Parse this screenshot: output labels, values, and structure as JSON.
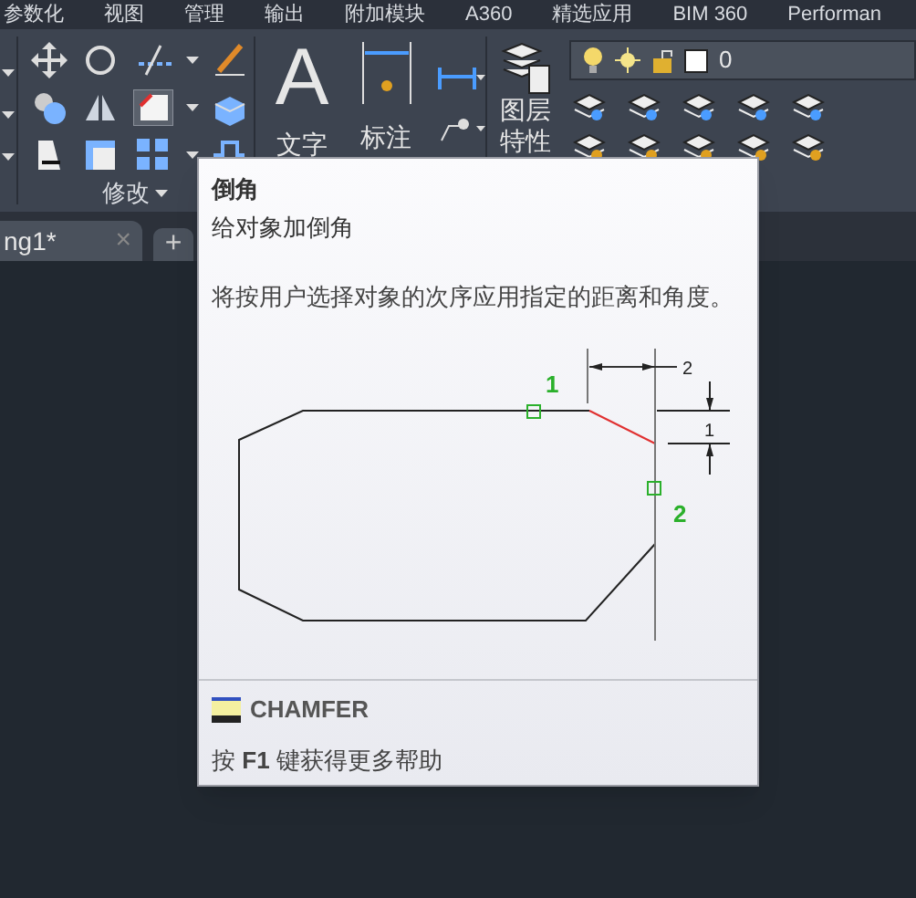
{
  "menu_tabs": [
    "参数化",
    "视图",
    "管理",
    "输出",
    "附加模块",
    "A360",
    "精选应用",
    "BIM 360",
    "Performan"
  ],
  "ribbon": {
    "panel_label": "修改",
    "text_glyph": "A",
    "text_button": "文字",
    "dimension_button": "标注",
    "layer_button": [
      "图层",
      "特性"
    ],
    "layer_value": "0"
  },
  "doc_tabs": [
    {
      "label": "ng1*",
      "selected": true,
      "close": "×"
    }
  ],
  "new_tab": "+",
  "tooltip": {
    "title": "倒角",
    "subtitle": "给对象加倒角",
    "description": "将按用户选择对象的次序应用指定的距离和角度。",
    "diagram": {
      "pick_labels": [
        "1",
        "2"
      ],
      "dimension_labels": [
        "2",
        "1"
      ]
    },
    "command": "CHAMFER",
    "help": "按 **F1** 键获得更多帮助"
  }
}
